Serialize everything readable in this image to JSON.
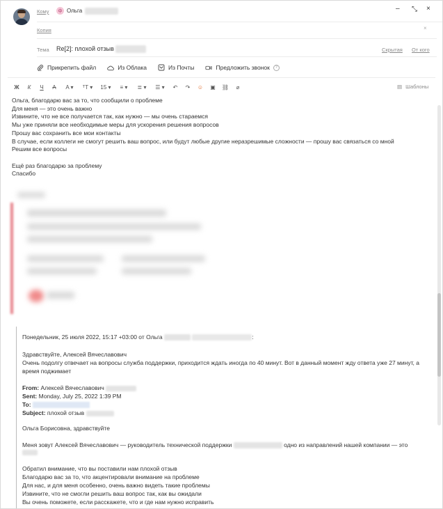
{
  "header": {
    "to_label": "Кому",
    "recipient_initial": "ф",
    "recipient_name": "Ольга",
    "copy_label": "Копия",
    "subject_label": "Тема",
    "subject_value": "Re[2]: плохой отзыв",
    "hidden_link": "Скрытая",
    "from_link": "От кого",
    "minimize": "–",
    "expand": "⤡",
    "close": "×",
    "copy_close": "×"
  },
  "attachments": {
    "attach_file": "Прикрепить файл",
    "from_cloud": "Из Облака",
    "from_mail": "Из Почты",
    "offer_call": "Предложить звонок",
    "help": "?"
  },
  "toolbar": {
    "bold": "Ж",
    "italic": "К",
    "underline": "Ч",
    "strike": "̶A",
    "text_color": "A",
    "font": "ᵀT",
    "size": "15",
    "align": "≡",
    "indent": "≣",
    "list": "☰",
    "undo": "↶",
    "redo": "↷",
    "emoji": "☺",
    "image": "▣",
    "link": "⛓",
    "clear": "⌀",
    "templates_label": "Шаблоны"
  },
  "body": {
    "lines": [
      "Ольга, благодарю вас за то, что сообщили о проблеме",
      "Для меня — это очень важно",
      "Извините, что не все получается так, как нужно — мы очень стараемся",
      "Мы уже приняли все необходимые меры для ускорения решения вопросов",
      "Прошу вас сохранить все мои контакты",
      "В случае, если коллеги не смогут решить ваш вопрос, или будут любые другие неразрешимые сложности — прошу вас связаться со мной",
      "Решим все вопросы"
    ],
    "lines2": [
      "Ещё раз благодарю за проблему",
      "Спасибо"
    ]
  },
  "quote": {
    "header_line": "Понедельник, 25 июля 2022, 15:17 +03:00 от Ольга",
    "greeting": "Здравствуйте, Алексей Вячеславович",
    "complaint_1": "Очень подолгу отвечает на вопросы служба поддержки, приходится ждать иногда по 40 минут. Вот в данный момент жду ответа уже 27 минут, а",
    "complaint_2": "время поджимает",
    "from_label": "From:",
    "from_value": "Алексей Вячеславович",
    "sent_label": "Sent:",
    "sent_value": "Monday, July 25, 2022 1:39 PM",
    "to_label": "To:",
    "subject_label": "Subject:",
    "subject_value": "плохой отзыв",
    "salutation": "Ольга Борисовна, здравствуйте",
    "intro_1": "Меня зовут Алексей Вячеславович — руководитель технической поддержки",
    "intro_2": "одно из направлений нашей компании — это",
    "p1": "Обратил внимание, что вы поставили нам плохой отзыв",
    "p2": "Благодарю вас за то, что акцентировали внимание на проблеме",
    "p3": "Для нас, и для меня особенно, очень важно видеть такие проблемы",
    "p4": "Извините, что не смогли решить ваш вопрос так, как вы ожидали",
    "p5": "Вы очень поможете, если расскажете, что и где нам нужно исправить"
  }
}
